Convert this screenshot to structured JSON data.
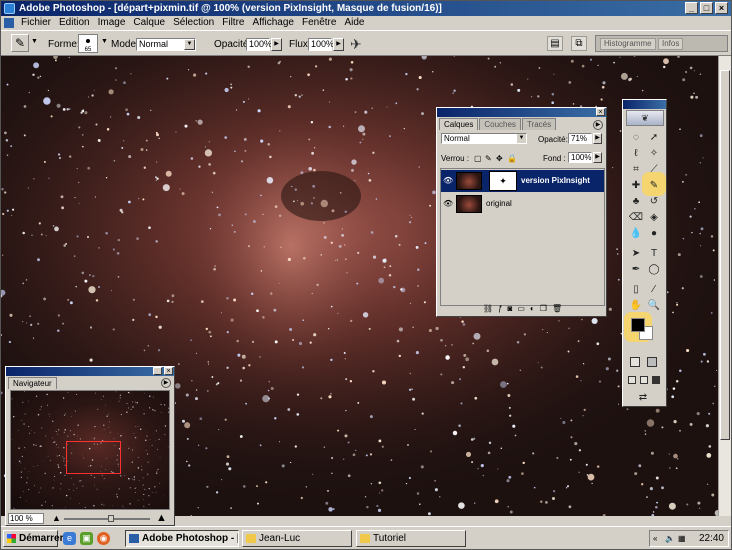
{
  "window": {
    "title": "Adobe Photoshop - [départ+pixmin.tif @ 100% (version PixInsight, Masque de fusion/16)]",
    "controls": [
      "_",
      "□",
      "×"
    ]
  },
  "menu": [
    "Fichier",
    "Edition",
    "Image",
    "Calque",
    "Sélection",
    "Filtre",
    "Affichage",
    "Fenêtre",
    "Aide"
  ],
  "options": {
    "forme_label": "Forme:",
    "brush_size": "65",
    "mode_label": "Mode:",
    "mode_value": "Normal",
    "opacite_label": "Opacité:",
    "opacite_value": "100%",
    "flux_label": "Flux:",
    "flux_value": "100%",
    "palette_well_tabs": [
      "Histogramme",
      "Infos"
    ]
  },
  "layers_panel": {
    "tabs": [
      "Calques",
      "Couches",
      "Tracés"
    ],
    "blend_mode": "Normal",
    "opacity_label": "Opacité:",
    "opacity_value": "71%",
    "lock_label": "Verrou :",
    "fill_label": "Fond :",
    "fill_value": "100%",
    "layers": [
      {
        "name": "version PixInsight",
        "selected": true,
        "has_mask": true
      },
      {
        "name": "original",
        "selected": false,
        "has_mask": false
      }
    ]
  },
  "navigator": {
    "tab": "Navigateur",
    "zoom": "100 %"
  },
  "taskbar": {
    "start_label": "Démarrer",
    "tasks": [
      "Adobe Photoshop - [d...",
      "Jean-Luc",
      "Tutoriel"
    ],
    "clock": "22:40"
  },
  "colors": {
    "title_blue": "#0a246a",
    "highlight_yellow": "#f7d566",
    "nav_view_box": "#ff3030"
  }
}
